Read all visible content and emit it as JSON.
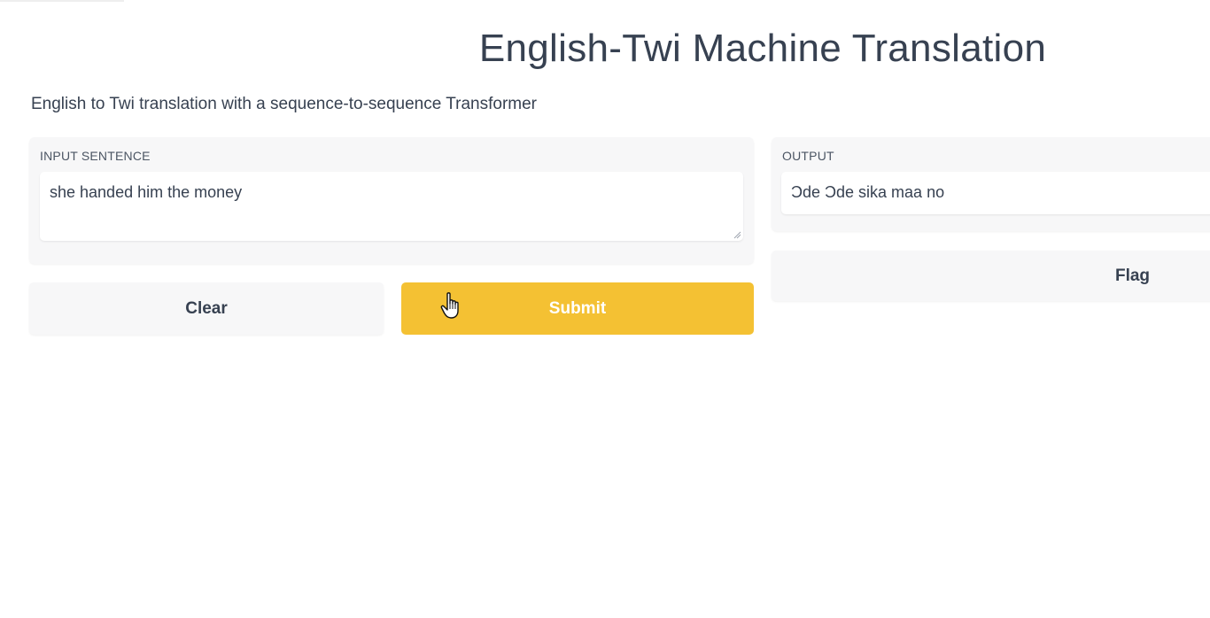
{
  "header": {
    "title": "English-Twi Machine Translation",
    "description": "English to Twi translation with a sequence-to-sequence Transformer"
  },
  "input": {
    "label": "INPUT SENTENCE",
    "value": "she handed him the money"
  },
  "output": {
    "label": "OUTPUT",
    "value": "Ɔde Ɔde sika maa no"
  },
  "buttons": {
    "clear_label": "Clear",
    "submit_label": "Submit",
    "flag_label": "Flag"
  },
  "colors": {
    "accent": "#f4c133",
    "panel_bg": "#f7f7f8",
    "text": "#374151"
  },
  "cursor": {
    "icon": "hand-pointer-icon"
  }
}
